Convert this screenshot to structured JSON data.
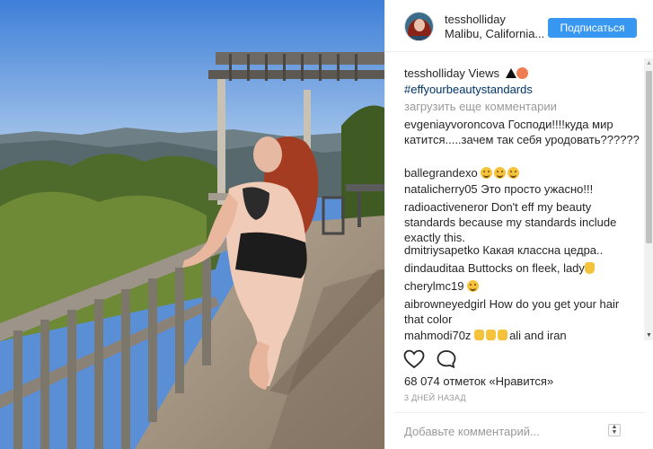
{
  "post": {
    "header": {
      "username": "tessholliday",
      "location": "Malibu, California...",
      "follow_label": "Подписаться"
    },
    "caption": {
      "username": "tessholliday",
      "text": " Views ",
      "hashtag": "#effyourbeautystandards"
    },
    "load_more": "загрузить еще комментарии",
    "comments": [
      {
        "author": "evgeniayvoroncova",
        "text": " Господи!!!!куда мир катится.....зачем так себя уродовать??????"
      },
      {
        "author": "ballegrandexo",
        "text": " "
      },
      {
        "author": "natalicherry05",
        "text": " Это просто ужасно!!!"
      },
      {
        "author": "radioactiveneror",
        "text": " Don't eff my beauty standards because my standards include exactly this."
      },
      {
        "author": "dmitriysapetko",
        "text": " Какая классна цедра.."
      },
      {
        "author": "dindauditaa",
        "text": " Buttocks on fleek, lady"
      },
      {
        "author": "cherylmc19",
        "text": " "
      },
      {
        "author": "aibrowneyedgirl",
        "text": " How do you get your hair that color"
      },
      {
        "author": "mahmodi70z",
        "text": " ",
        "tail": "ali and iran"
      }
    ],
    "likes": "68 074 отметок «Нравится»",
    "time_ago": "3 ДНЕЙ НАЗАД",
    "comment_placeholder": "Добавьте комментарий...",
    "icons": {
      "like": "heart-icon",
      "comment": "speech-bubble-icon",
      "more": "more-options-icon"
    },
    "colors": {
      "follow_button": "#3897f0",
      "hashtag": "#003569",
      "muted_text": "#999999"
    }
  }
}
